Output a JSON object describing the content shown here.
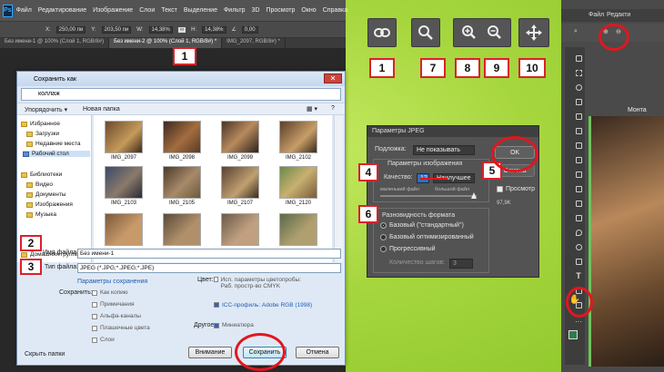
{
  "ps_menu": {
    "logo": "Ps",
    "items": [
      "Файл",
      "Редактирование",
      "Изображение",
      "Слои",
      "Текст",
      "Выделение",
      "Фильтр",
      "3D",
      "Просмотр",
      "Окно",
      "Справка"
    ]
  },
  "ps_options": [
    "X:",
    "250,00 пи",
    "Y:",
    "203,50 пи",
    "W:",
    "14,38%",
    "H:",
    "14,38%",
    "0,00"
  ],
  "ps_tabs": [
    "Без имени-1 @ 100% (Слой 1, RGB/8#)",
    "Без имени-2 @ 100% (Слой 1, RGB/8#) *",
    "IMG_2097, RGB/8#) *"
  ],
  "labels": {
    "n1": "1",
    "n2": "2",
    "n3": "3",
    "n4": "4",
    "n5": "5",
    "n6": "6",
    "n7": "7",
    "n8": "8",
    "n9": "9",
    "n10": "10",
    "r1": "1"
  },
  "save_dialog": {
    "title": "Сохранить как",
    "path": "коллаж",
    "organize": "Упорядочить ▾",
    "new_folder": "Новая папка",
    "nav": {
      "favorites": "Избранное",
      "downloads": "Загрузки",
      "recent": "Недавние места",
      "desktop": "Рабочий стол",
      "libraries": "Библиотеки",
      "video": "Видео",
      "documents": "Документы",
      "images": "Изображения",
      "music": "Музыка",
      "homegroup": "Домашняя группа"
    },
    "thumbs": [
      "IMG_2097",
      "IMG_2098",
      "IMG_2099",
      "IMG_2102",
      "IMG_2103",
      "IMG_2105",
      "IMG_2107",
      "IMG_2120"
    ],
    "filename_label": "Имя файла:",
    "filename_value": "Без имени-1",
    "filetype_label": "Тип файла:",
    "filetype_value": "JPEG (*.JPG;*.JPEG;*.JPE)",
    "save_options_title": "Параметры сохранения",
    "save_label": "Сохранить:",
    "as_copy": "Как копию",
    "notes": "Примечания",
    "alpha": "Альфа-каналы",
    "spot": "Плашечные цвета",
    "layers": "Слои",
    "color_label": "Цвет:",
    "proof": "Исп. параметры цветопробы: Раб. простр-во CMYK",
    "icc": "ICC-профиль: Adobe RGB (1998)",
    "other_label": "Другое:",
    "thumbnail": "Миниатюра",
    "hide_folders": "Скрыть папки",
    "warning_btn": "Внимание",
    "save_btn": "Сохранить",
    "cancel_btn": "Отмена"
  },
  "jpeg_dialog": {
    "title": "Параметры JPEG",
    "matte_label": "Подложка:",
    "matte_value": "Не показывать",
    "image_options": "Параметры изображения",
    "quality_label": "Качество:",
    "quality_value": "12",
    "quality_preset": "Наилучшее",
    "small_file": "маленький файл",
    "large_file": "большой файл",
    "format_title": "Разновидность формата",
    "baseline_std": "Базовый (\"стандартный\")",
    "baseline_opt": "Базовый оптимизированный",
    "progressive": "Прогрессивный",
    "scans_label": "Количество шагов:",
    "scans_value": "3",
    "ok": "OK",
    "cancel": "Отмена",
    "preview": "Просмотр",
    "size": "97,9K"
  },
  "ps_right": {
    "menu": [
      "Файл",
      "Редакти"
    ],
    "panel_label": "Монта"
  },
  "colors": {
    "red": "#d9222a",
    "green_bg": "#a6d63e",
    "ps_dark": "#535353"
  }
}
